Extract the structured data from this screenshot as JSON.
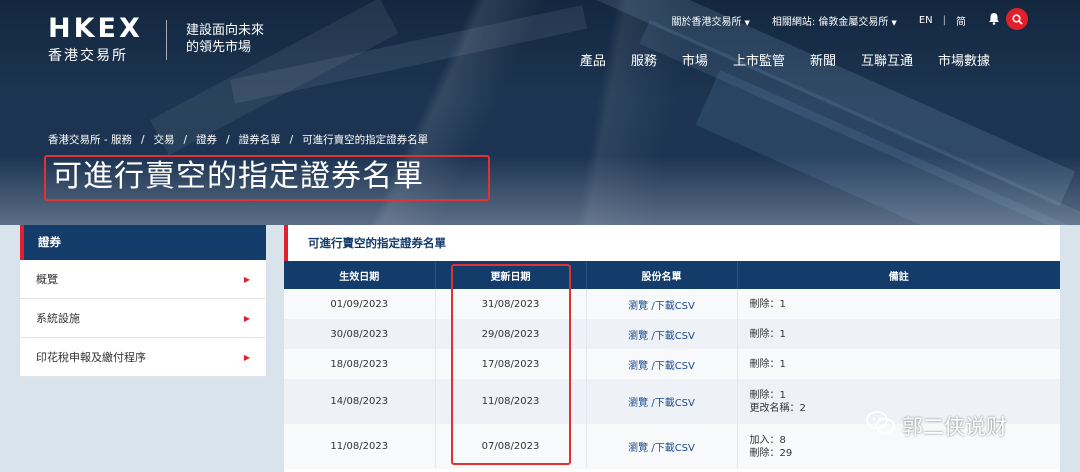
{
  "header": {
    "logo_top": "HKEX",
    "logo_sub": "香港交易所",
    "tagline_line1": "建設面向未來",
    "tagline_line2": "的領先市場",
    "utility": {
      "about": "關於香港交易所",
      "related": "相關網站: 倫敦金屬交易所",
      "lang_en": "EN",
      "lang_sc": "简"
    },
    "nav": [
      "產品",
      "服務",
      "市場",
      "上市監管",
      "新聞",
      "互聯互通",
      "市場數據"
    ]
  },
  "breadcrumb": [
    "香港交易所 - 服務",
    "交易",
    "證券",
    "證券名單",
    "可進行賣空的指定證券名單"
  ],
  "page_title": "可進行賣空的指定證券名單",
  "sidebar": {
    "header": "證券",
    "items": [
      {
        "label": "概覽"
      },
      {
        "label": "系統設施"
      },
      {
        "label": "印花稅申報及繳付程序"
      }
    ]
  },
  "panel": {
    "title": "可進行賣空的指定證券名單",
    "columns": [
      "生效日期",
      "更新日期",
      "股份名單",
      "備註"
    ],
    "rows": [
      {
        "effective": "01/09/2023",
        "updated": "31/08/2023",
        "list": "瀏覽 /下載CSV",
        "note1": "刪除：1",
        "note2": ""
      },
      {
        "effective": "30/08/2023",
        "updated": "29/08/2023",
        "list": "瀏覽 /下載CSV",
        "note1": "刪除：1",
        "note2": ""
      },
      {
        "effective": "18/08/2023",
        "updated": "17/08/2023",
        "list": "瀏覽 /下載CSV",
        "note1": "刪除：1",
        "note2": ""
      },
      {
        "effective": "14/08/2023",
        "updated": "11/08/2023",
        "list": "瀏覽 /下載CSV",
        "note1": "刪除：1",
        "note2": "更改名稱：2"
      },
      {
        "effective": "11/08/2023",
        "updated": "07/08/2023",
        "list": "瀏覽 /下載CSV",
        "note1": "加入：8",
        "note2": "刪除：29"
      }
    ]
  },
  "watermark": "郭二侠说财",
  "colors": {
    "navy": "#143c6b",
    "accent_red": "#e0202c",
    "highlight_box": "#e03232"
  }
}
